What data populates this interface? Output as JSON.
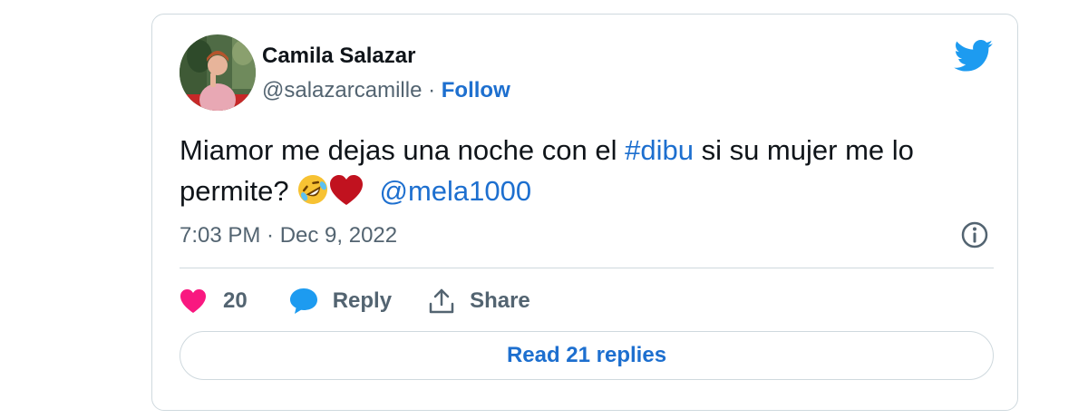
{
  "tweet": {
    "author": {
      "name": "Camila Salazar",
      "handle": "@salazarcamille",
      "separator": "·",
      "follow_label": "Follow",
      "avatar_icon": "user-avatar-photo"
    },
    "text": {
      "part1": "Miamor me dejas una noche con el ",
      "hashtag": "#dibu",
      "part2": " si su mujer me lo permite? ",
      "emojis": [
        "rolling-on-floor-laughing-emoji",
        "red-heart-emoji"
      ],
      "mention": "@mela1000"
    },
    "timestamp": "7:03 PM · Dec 9, 2022",
    "actions": {
      "like_count": "20",
      "reply_label": "Reply",
      "share_label": "Share"
    },
    "read_replies_label": "Read 21 replies"
  },
  "colors": {
    "link_blue": "#1d6fcf",
    "twitter_blue": "#1d9bf0",
    "like_pink": "#f91880",
    "heart_red": "#c1121f",
    "text_dark": "#0f1419",
    "text_gray": "#536471",
    "border": "#cfd9de"
  },
  "icons": {
    "brand": "twitter-bird-icon",
    "info": "info-icon",
    "like": "heart-icon",
    "reply": "speech-bubble-icon",
    "share": "share-upload-icon"
  }
}
